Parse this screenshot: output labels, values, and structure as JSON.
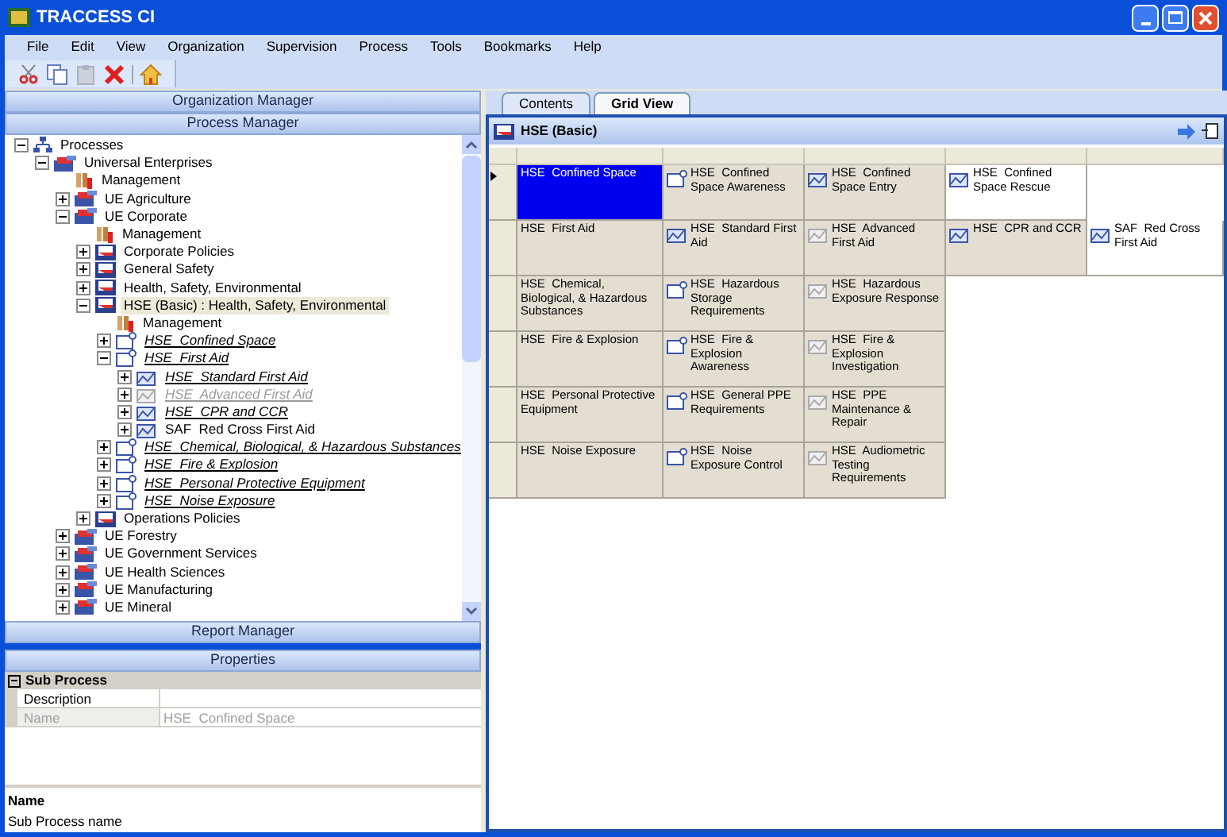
{
  "window": {
    "title": "TRACCESS CI"
  },
  "menu": [
    "File",
    "Edit",
    "View",
    "Organization",
    "Supervision",
    "Process",
    "Tools",
    "Bookmarks",
    "Help"
  ],
  "toolbar": [
    {
      "kind": "cut",
      "disabled": false
    },
    {
      "kind": "copy",
      "disabled": false
    },
    {
      "kind": "paste",
      "disabled": true
    },
    {
      "kind": "delete",
      "disabled": false
    },
    {
      "kind": "home",
      "disabled": false
    }
  ],
  "left_headers": {
    "organization": "Organization Manager",
    "process": "Process Manager",
    "report": "Report Manager",
    "properties": "Properties"
  },
  "tree": [
    {
      "label": "Processes",
      "kind": "root",
      "expanded": true,
      "selected": false,
      "linked": false,
      "disabled": false,
      "children": [
        {
          "label": "Universal Enterprises",
          "kind": "org",
          "expanded": true,
          "selected": false,
          "linked": false,
          "disabled": false,
          "children": [
            {
              "label": "Management",
              "kind": "management",
              "selected": false,
              "linked": false,
              "disabled": false
            },
            {
              "label": "UE Agriculture",
              "kind": "org",
              "expanded": false,
              "selected": false,
              "linked": false,
              "disabled": false
            },
            {
              "label": "UE Corporate",
              "kind": "org",
              "expanded": true,
              "selected": false,
              "linked": false,
              "disabled": false,
              "children": [
                {
                  "label": "Management",
                  "kind": "management",
                  "selected": false,
                  "linked": false,
                  "disabled": false
                },
                {
                  "label": "Corporate Policies",
                  "kind": "policy",
                  "expanded": false,
                  "selected": false,
                  "linked": false,
                  "disabled": false
                },
                {
                  "label": "General Safety",
                  "kind": "policy",
                  "expanded": false,
                  "selected": false,
                  "linked": false,
                  "disabled": false
                },
                {
                  "label": "Health, Safety, Environmental",
                  "kind": "policy",
                  "expanded": false,
                  "selected": false,
                  "linked": false,
                  "disabled": false
                },
                {
                  "label": "HSE (Basic) : Health, Safety, Environmental",
                  "kind": "policy",
                  "expanded": true,
                  "selected": true,
                  "linked": false,
                  "disabled": false,
                  "children": [
                    {
                      "label": "Management",
                      "kind": "management",
                      "selected": false,
                      "linked": false,
                      "disabled": false
                    },
                    {
                      "label": "HSE  Confined Space",
                      "kind": "subprocess",
                      "expanded": false,
                      "selected": false,
                      "linked": true,
                      "disabled": false
                    },
                    {
                      "label": "HSE  First Aid",
                      "kind": "subprocess",
                      "expanded": true,
                      "selected": false,
                      "linked": true,
                      "disabled": false,
                      "children": [
                        {
                          "label": "HSE  Standard First Aid",
                          "kind": "task",
                          "expanded": false,
                          "selected": false,
                          "linked": true,
                          "disabled": false
                        },
                        {
                          "label": "HSE  Advanced First Aid",
                          "kind": "task",
                          "expanded": false,
                          "selected": false,
                          "linked": true,
                          "disabled": true
                        },
                        {
                          "label": "HSE  CPR and CCR",
                          "kind": "task",
                          "expanded": false,
                          "selected": false,
                          "linked": true,
                          "disabled": false
                        },
                        {
                          "label": "SAF  Red Cross First Aid",
                          "kind": "task",
                          "expanded": false,
                          "selected": false,
                          "linked": false,
                          "disabled": false
                        }
                      ]
                    },
                    {
                      "label": "HSE  Chemical, Biological, & Hazardous Substances",
                      "kind": "subprocess",
                      "expanded": false,
                      "selected": false,
                      "linked": true,
                      "disabled": false
                    },
                    {
                      "label": "HSE  Fire & Explosion",
                      "kind": "subprocess",
                      "expanded": false,
                      "selected": false,
                      "linked": true,
                      "disabled": false
                    },
                    {
                      "label": "HSE  Personal Protective Equipment",
                      "kind": "subprocess",
                      "expanded": false,
                      "selected": false,
                      "linked": true,
                      "disabled": false
                    },
                    {
                      "label": "HSE  Noise Exposure",
                      "kind": "subprocess",
                      "expanded": false,
                      "selected": false,
                      "linked": true,
                      "disabled": false
                    }
                  ]
                },
                {
                  "label": "Operations Policies",
                  "kind": "policy",
                  "expanded": false,
                  "selected": false,
                  "linked": false,
                  "disabled": false
                }
              ]
            },
            {
              "label": "UE Forestry",
              "kind": "org",
              "expanded": false,
              "selected": false,
              "linked": false,
              "disabled": false
            },
            {
              "label": "UE Government Services",
              "kind": "org",
              "expanded": false,
              "selected": false,
              "linked": false,
              "disabled": false
            },
            {
              "label": "UE Health Sciences",
              "kind": "org",
              "expanded": false,
              "selected": false,
              "linked": false,
              "disabled": false
            },
            {
              "label": "UE Manufacturing",
              "kind": "org",
              "expanded": false,
              "selected": false,
              "linked": false,
              "disabled": false
            },
            {
              "label": "UE Mineral",
              "kind": "org",
              "expanded": false,
              "selected": false,
              "linked": false,
              "disabled": false
            }
          ]
        }
      ]
    }
  ],
  "properties": {
    "category": "Sub Process",
    "rows": [
      {
        "name": "Description",
        "disabled": false
      },
      {
        "name": "Name",
        "value": "HSE  Confined Space",
        "disabled": true
      }
    ],
    "help_title": "Name",
    "help_text": "Sub Process name"
  },
  "tabs": [
    {
      "label": "Contents",
      "selected": false
    },
    {
      "label": "Grid View",
      "selected": true
    }
  ],
  "panel": {
    "title": "HSE (Basic)"
  },
  "grid": {
    "rows": [
      {
        "current": true,
        "cells": [
          {
            "label": "HSE  Confined Space",
            "kind": "process",
            "selected": true
          },
          {
            "label": "HSE  Confined Space Awareness",
            "kind": "subprocess",
            "selected": false,
            "shaded": true,
            "disabled": false
          },
          {
            "label": "HSE  Confined Space Entry",
            "kind": "task",
            "selected": false,
            "shaded": true,
            "disabled": false
          },
          {
            "label": "HSE  Confined Space Rescue",
            "kind": "task",
            "selected": false,
            "shaded": false,
            "disabled": false
          }
        ]
      },
      {
        "current": false,
        "cells": [
          {
            "label": "HSE  First Aid",
            "kind": "process",
            "selected": false,
            "shaded": true
          },
          {
            "label": "HSE  Standard First Aid",
            "kind": "task",
            "selected": false,
            "shaded": true,
            "disabled": false
          },
          {
            "label": "HSE  Advanced First Aid",
            "kind": "task",
            "selected": false,
            "shaded": true,
            "disabled": true
          },
          {
            "label": "HSE  CPR and CCR",
            "kind": "task",
            "selected": false,
            "shaded": true,
            "disabled": false
          },
          {
            "label": "SAF  Red Cross First Aid",
            "kind": "task",
            "selected": false,
            "shaded": false,
            "disabled": false
          }
        ]
      },
      {
        "current": false,
        "cells": [
          {
            "label": "HSE  Chemical, Biological, & Hazardous Substances",
            "kind": "process",
            "selected": false,
            "shaded": true
          },
          {
            "label": "HSE  Hazardous Storage Requirements",
            "kind": "subprocess",
            "selected": false,
            "shaded": true,
            "disabled": false
          },
          {
            "label": "HSE  Hazardous Exposure Response",
            "kind": "task",
            "selected": false,
            "shaded": true,
            "disabled": true
          }
        ]
      },
      {
        "current": false,
        "cells": [
          {
            "label": "HSE  Fire & Explosion",
            "kind": "process",
            "selected": false,
            "shaded": true
          },
          {
            "label": "HSE  Fire & Explosion Awareness",
            "kind": "subprocess",
            "selected": false,
            "shaded": true,
            "disabled": false
          },
          {
            "label": "HSE  Fire & Explosion Investigation",
            "kind": "task",
            "selected": false,
            "shaded": true,
            "disabled": true
          }
        ]
      },
      {
        "current": false,
        "cells": [
          {
            "label": "HSE  Personal Protective Equipment",
            "kind": "process",
            "selected": false,
            "shaded": true
          },
          {
            "label": "HSE  General PPE Requirements",
            "kind": "subprocess",
            "selected": false,
            "shaded": true,
            "disabled": false
          },
          {
            "label": "HSE  PPE Maintenance & Repair",
            "kind": "task",
            "selected": false,
            "shaded": true,
            "disabled": true
          }
        ]
      },
      {
        "current": false,
        "cells": [
          {
            "label": "HSE  Noise Exposure",
            "kind": "process",
            "selected": false,
            "shaded": true
          },
          {
            "label": "HSE  Noise Exposure Control",
            "kind": "subprocess",
            "selected": false,
            "shaded": true,
            "disabled": false
          },
          {
            "label": "HSE  Audiometric Testing Requirements",
            "kind": "task",
            "selected": false,
            "shaded": true,
            "disabled": true
          }
        ]
      }
    ]
  }
}
